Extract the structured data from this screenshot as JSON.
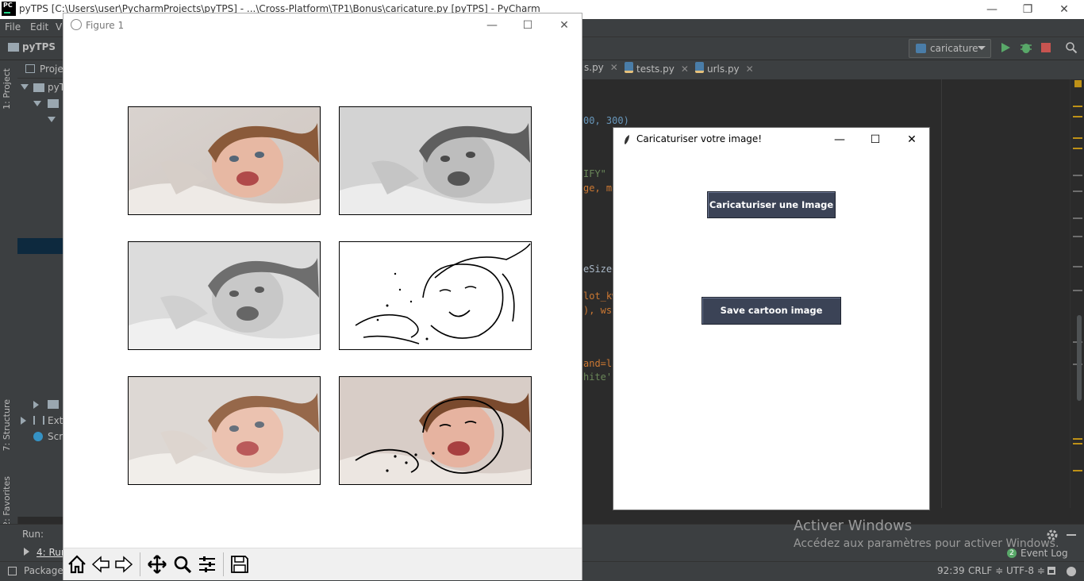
{
  "ide": {
    "title": "pyTPS [C:\\Users\\user\\PycharmProjects\\pyTPS] - ...\\Cross-Platform\\TP1\\Bonus\\caricature.py [pyTPS] - PyCharm",
    "logo_text": "PC",
    "window_controls": {
      "minimize": "—",
      "restore": "❐",
      "close": "✕"
    },
    "menu": {
      "file": "File",
      "edit": "Edit",
      "view": "V"
    },
    "nav_project": "pyTPS",
    "run_config": "caricature",
    "left_tabs": {
      "project": "1: Project",
      "structure": "7: Structure",
      "favorites": "2: Favorites"
    },
    "project_panel": {
      "tab": "Proje",
      "rows": [
        "pyT",
        "Exte",
        "Scri"
      ]
    },
    "editor_tabs": [
      {
        "label": "s.py",
        "close": "✕"
      },
      {
        "label": "tests.py",
        "close": "✕"
      },
      {
        "label": "urls.py",
        "close": "✕"
      }
    ],
    "code_fragments": [
      {
        "text": "00, 300)",
        "color": "#6897bb"
      },
      {
        "text": "IFY\"",
        "color": "#6a8759"
      },
      {
        "text": "ge, ma",
        "color": "#cc7832"
      },
      {
        "text": "eSized",
        "color": "#a9b7c6"
      },
      {
        "text": "lot_kw",
        "color": "#cc7832"
      },
      {
        "text": "), wsp",
        "color": "#cc7832"
      },
      {
        "text": "and=la",
        "color": "#cc7832"
      },
      {
        "text": "hite',",
        "color": "#6a8759"
      }
    ],
    "run_panel": {
      "label": "Run:",
      "tab": "4: Run"
    },
    "status": {
      "packages": "Packages",
      "position": "92:39",
      "line_sep": "CRLF ≑",
      "encoding": "UTF-8 ≑",
      "event_log": "Event Log",
      "event_count": "2"
    },
    "activate": {
      "title": "Activer Windows",
      "subtitle": "Accédez aux paramètres pour activer Windows."
    }
  },
  "figure": {
    "title": "Figure 1",
    "controls": {
      "minimize": "—",
      "maximize": "☐",
      "close": "✕"
    },
    "toolbar": [
      "home-icon",
      "back-icon",
      "forward-icon",
      "pan-icon",
      "zoom-icon",
      "configure-icon",
      "save-icon"
    ]
  },
  "tk": {
    "title": "Caricaturiser votre image!",
    "controls": {
      "minimize": "—",
      "maximize": "☐",
      "close": "✕"
    },
    "button_caricature": "Caricaturiser une  Image",
    "button_save": "Save cartoon image"
  }
}
